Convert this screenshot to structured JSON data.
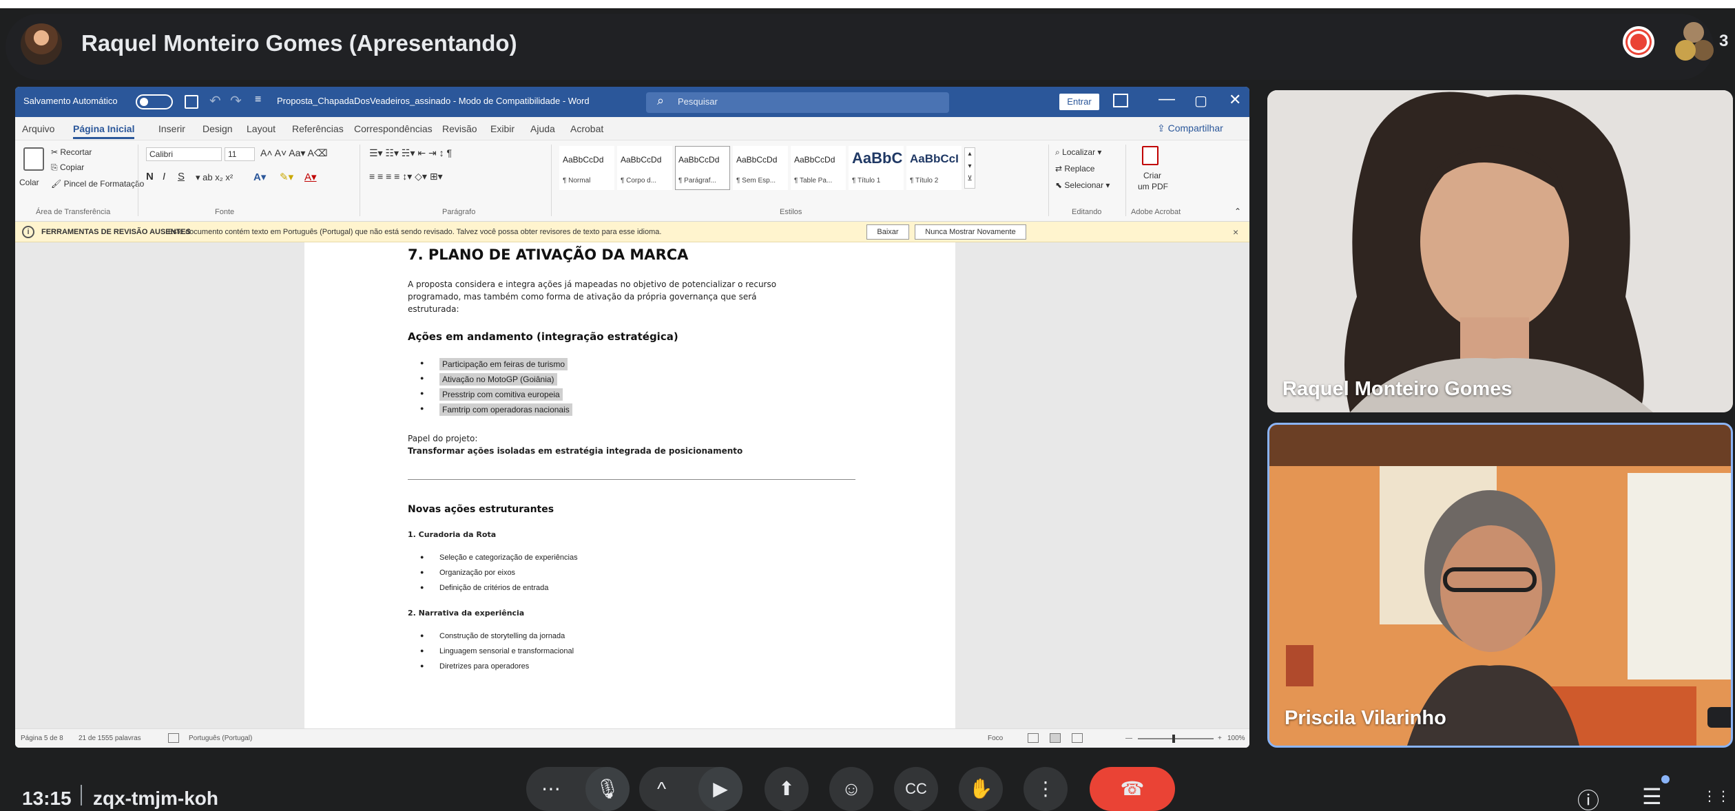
{
  "meet": {
    "presenter_title": "Raquel Monteiro Gomes (Apresentando)",
    "participant_count": "3",
    "clock": "13:15",
    "meeting_code": "zqx-tmjm-koh",
    "participants": [
      {
        "name": "Raquel Monteiro Gomes"
      },
      {
        "name": "Priscila Vilarinho"
      }
    ],
    "controls": {
      "more_dots": "⋯",
      "mic": "🎙",
      "chevron": "^",
      "camera": "▶",
      "present": "⬆",
      "emoji": "☺",
      "captions": "CC",
      "raise_hand": "✋",
      "more_vert": "⋮",
      "end_call": "☎"
    },
    "right_controls": {
      "info": "ⓘ",
      "chat": "☰",
      "activities": "⋮⋮⋮"
    },
    "colors": {
      "end_call": "#ea4335",
      "tile_highlight": "#8ab4f8"
    }
  },
  "word": {
    "titlebar": {
      "autosave": "Salvamento Automático",
      "doc_title": "Proposta_ChapadaDosVeadeiros_assinado - Modo de Compatibilidade - Word",
      "search_placeholder": "Pesquisar",
      "signin": "Entrar",
      "minimize": "—",
      "restore": "▢",
      "close": "✕"
    },
    "tabs": [
      "Arquivo",
      "Página Inicial",
      "Inserir",
      "Design",
      "Layout",
      "Referências",
      "Correspondências",
      "Revisão",
      "Exibir",
      "Ajuda",
      "Acrobat"
    ],
    "share": "Compartilhar",
    "ribbon": {
      "clipboard": {
        "paste": "Colar",
        "cut": "Recortar",
        "copy": "Copiar",
        "format_painter": "Pincel de Formatação",
        "group": "Área de Transferência"
      },
      "font": {
        "name": "Calibri",
        "size": "11",
        "group": "Fonte"
      },
      "paragraph": {
        "group": "Parágrafo"
      },
      "styles": {
        "items": [
          {
            "sample": "AaBbCcDd",
            "name": "¶ Normal"
          },
          {
            "sample": "AaBbCcDd",
            "name": "¶ Corpo d..."
          },
          {
            "sample": "AaBbCcDd",
            "name": "¶ Parágraf..."
          },
          {
            "sample": "AaBbCcDd",
            "name": "¶ Sem Esp..."
          },
          {
            "sample": "AaBbCcDd",
            "name": "¶ Table Pa..."
          },
          {
            "sample": "AaBbC",
            "name": "¶ Título 1"
          },
          {
            "sample": "AaBbCcI",
            "name": "¶ Título 2"
          }
        ],
        "group": "Estilos"
      },
      "editing": {
        "find": "Localizar",
        "replace": "Replace",
        "select": "Selecionar",
        "group": "Editando"
      },
      "acrobat": {
        "create_pdf_line1": "Criar",
        "create_pdf_line2": "um PDF",
        "group": "Adobe Acrobat"
      }
    },
    "notice": {
      "title": "FERRAMENTAS DE REVISÃO AUSENTES",
      "text": "Este documento contém texto em Português (Portugal) que não está sendo revisado. Talvez você possa obter revisores de texto para esse idioma.",
      "button_review": "Baixar",
      "button_never": "Nunca Mostrar Novamente",
      "close": "×"
    },
    "document": {
      "heading": "7. PLANO DE ATIVAÇÃO DA MARCA",
      "intro_lines": [
        "A proposta considera e integra ações já mapeadas no objetivo de potencializar o recurso",
        "programado, mas também como forma de ativação da própria governança que será",
        "estruturada:"
      ],
      "section1_title": "Ações em andamento (integração estratégica)",
      "section1_items": [
        "Participação em feiras de turismo",
        "Ativação no MotoGP (Goiânia)",
        "Presstrip com comitiva europeia",
        "Famtrip com operadoras nacionais"
      ],
      "role_label": "Papel do projeto:",
      "role_text": "Transformar ações isoladas em estratégia integrada de posicionamento",
      "section2_title": "Novas ações estruturantes",
      "sub1_title": "1. Curadoria da Rota",
      "sub1_items": [
        "Seleção e categorização de experiências",
        "Organização por eixos",
        "Definição de critérios de entrada"
      ],
      "sub2_title": "2. Narrativa da experiência",
      "sub2_items": [
        "Construção de storytelling da jornada",
        "Linguagem sensorial e transformacional",
        "Diretrizes para operadores"
      ]
    },
    "statusbar": {
      "page": "Página 5 de 8",
      "words": "21 de 1555 palavras",
      "language": "Português (Portugal)",
      "focus": "Foco",
      "zoom": "100%"
    },
    "colors": {
      "titlebar": "#2b579a",
      "notice": "#fff4ce"
    }
  }
}
